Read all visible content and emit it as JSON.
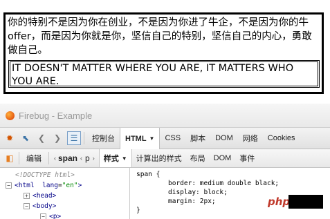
{
  "demo": {
    "paragraph": "你的特别不是因为你在创业，不是因为你进了牛企，不是因为你的牛offer，而是因为你就是你，坚信自己的特别，坚信自己的内心，勇敢做自己。",
    "span_text": "IT DOESN'T MATTER WHERE YOU ARE, IT MATTERS WHO YOU ARE."
  },
  "firebug": {
    "title": "Firebug - Example",
    "main_tabs": [
      "控制台",
      "HTML",
      "CSS",
      "脚本",
      "DOM",
      "网络",
      "Cookies"
    ],
    "edit_label": "编辑",
    "breadcrumb": [
      "span",
      "p"
    ],
    "side_tabs": [
      "样式",
      "计算出的样式",
      "布局",
      "DOM",
      "事件"
    ],
    "tree": {
      "doctype": "<!DOCTYPE html>",
      "html_tag": "html",
      "lang_attr": "lang",
      "lang_val": "\"en\"",
      "head": "<head>",
      "body": "<body>",
      "p": "<p>"
    },
    "css": {
      "selector": "span {",
      "rules": [
        "border: medium double black;",
        "display: block;",
        "margin: 2px;"
      ],
      "close": "}"
    }
  },
  "watermark": "php"
}
